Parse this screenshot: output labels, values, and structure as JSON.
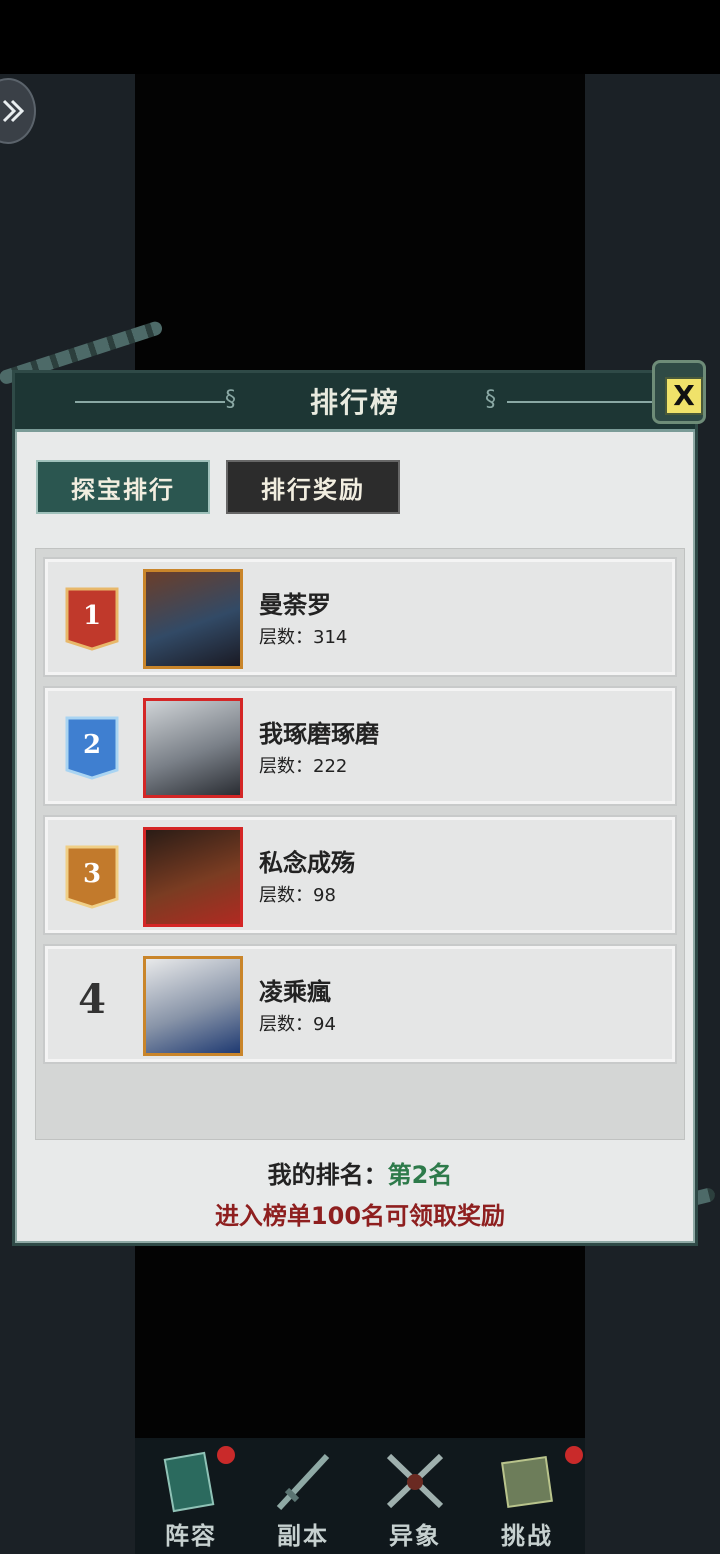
{
  "panel": {
    "title": "排行榜",
    "close_label": "X"
  },
  "tabs": [
    {
      "label": "探宝排行",
      "active": true
    },
    {
      "label": "排行奖励",
      "active": false
    }
  ],
  "rankings": [
    {
      "rank": "1",
      "name": "曼荼罗",
      "floors_label": "层数：",
      "floors": "314",
      "badge_color": "#c0392b",
      "frame_color": "#c9852a"
    },
    {
      "rank": "2",
      "name": "我琢磨琢磨",
      "floors_label": "层数：",
      "floors": "222",
      "badge_color": "#3f7fd0",
      "frame_color": "#d42626"
    },
    {
      "rank": "3",
      "name": "私念成殇",
      "floors_label": "层数：",
      "floors": "98",
      "badge_color": "#c27a2c",
      "frame_color": "#d42626"
    },
    {
      "rank": "4",
      "name": "凌乘瘋",
      "floors_label": "层数：",
      "floors": "94",
      "badge_color": "",
      "frame_color": "#c9852a"
    }
  ],
  "my_rank": {
    "label": "我的排名：",
    "value": "第2名"
  },
  "reward_note": "进入榜单100名可领取奖励",
  "bottom_nav": [
    {
      "label": "阵容",
      "icon": "book-icon",
      "has_badge": true
    },
    {
      "label": "副本",
      "icon": "sword-icon",
      "has_badge": false
    },
    {
      "label": "异象",
      "icon": "crossed-swords-icon",
      "has_badge": false
    },
    {
      "label": "挑战",
      "icon": "scroll-icon",
      "has_badge": true
    }
  ]
}
